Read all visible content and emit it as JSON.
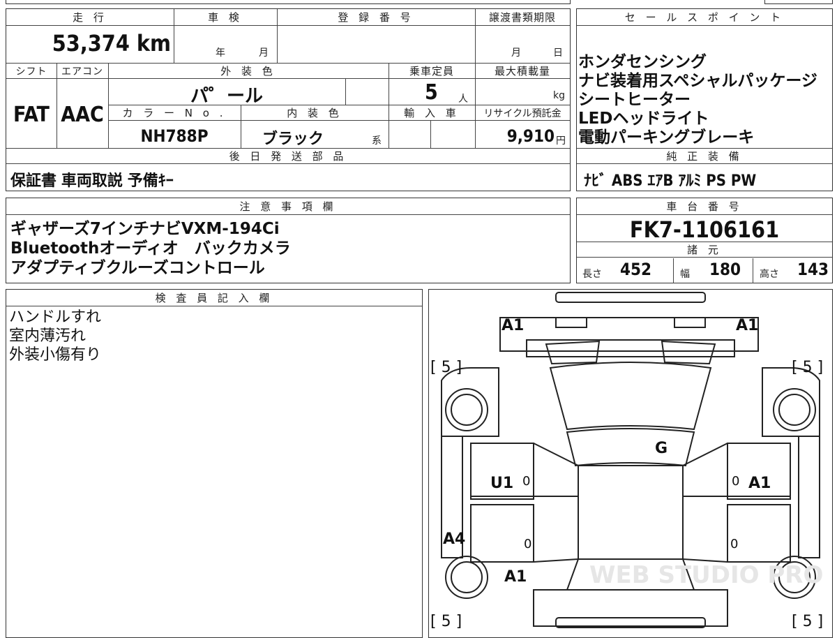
{
  "top": {
    "headers": {
      "mileage": "走 行",
      "inspection": "車 検",
      "registration": "登 録 番 号",
      "transfer": "譲渡書類期限",
      "sales": "セ ー ル ス ポ イ ン ト",
      "shift": "シフト",
      "ac": "エアコン",
      "exterior_color": "外 装 色",
      "capacity": "乗車定員",
      "max_load": "最大積載量",
      "color_no": "カ ラ ー N o .",
      "interior_color": "内 装 色",
      "import": "輸 入 車",
      "recycle": "リサイクル預託金",
      "later_parts": "後 日 発 送 部 品",
      "genuine": "純 正 装 備",
      "notes": "注 意 事 項 欄",
      "chassis": "車 台 番 号",
      "specs": "諸 元",
      "inspector": "検 査 員 記 入 欄"
    },
    "mileage_value": "53,374 km",
    "inspection_year": "年",
    "inspection_month": "月",
    "transfer_month": "月",
    "transfer_day": "日",
    "shift_value": "FAT",
    "ac_value": "AAC",
    "exterior_value": "パ゜ール",
    "capacity_value": "5",
    "capacity_unit": "人",
    "load_unit": "kg",
    "color_no_value": "NH788P",
    "interior_value": "ブラック",
    "interior_suffix": "系",
    "recycle_value": "9,910",
    "recycle_unit": "円"
  },
  "sales_points": [
    "ホンダセンシング",
    "ナビ装着用スペシャルパッケージ",
    "シートヒーター",
    "LEDヘッドライト",
    "電動パーキングブレーキ"
  ],
  "later_parts_value": "保証書 車両取説 予備ｷｰ",
  "genuine_value": "ﾅﾋﾞ ABS ｴｱB ｱﾙﾐ PS PW",
  "notes_lines": [
    "ギャザーズ7インチナビVXM-194Ci",
    "Bluetoothオーディオ　バックカメラ",
    "アダプティブクルーズコントロール"
  ],
  "chassis_value": "FK7-1106161",
  "specs": {
    "length_label": "長さ",
    "length_value": "452",
    "width_label": "幅",
    "width_value": "180",
    "height_label": "高さ",
    "height_value": "143"
  },
  "inspector_lines": [
    "ハンドルすれ",
    "室内薄汚れ",
    "外装小傷有り"
  ],
  "diagram": {
    "front_left": "A1",
    "front_right": "A1",
    "tire_fl": "[ 5 ]",
    "tire_fr": "[ 5 ]",
    "tire_rl": "[ 5 ]",
    "tire_rr": "[ 5 ]",
    "glass": "G",
    "left_front_door": "U1",
    "right_front_door": "A1",
    "left_rear_panel": "A4",
    "left_rear_door": "A1",
    "zero1": "0",
    "zero2": "0",
    "zero3": "0",
    "zero4": "0",
    "watermark": "WEB STUDIO PRO"
  }
}
